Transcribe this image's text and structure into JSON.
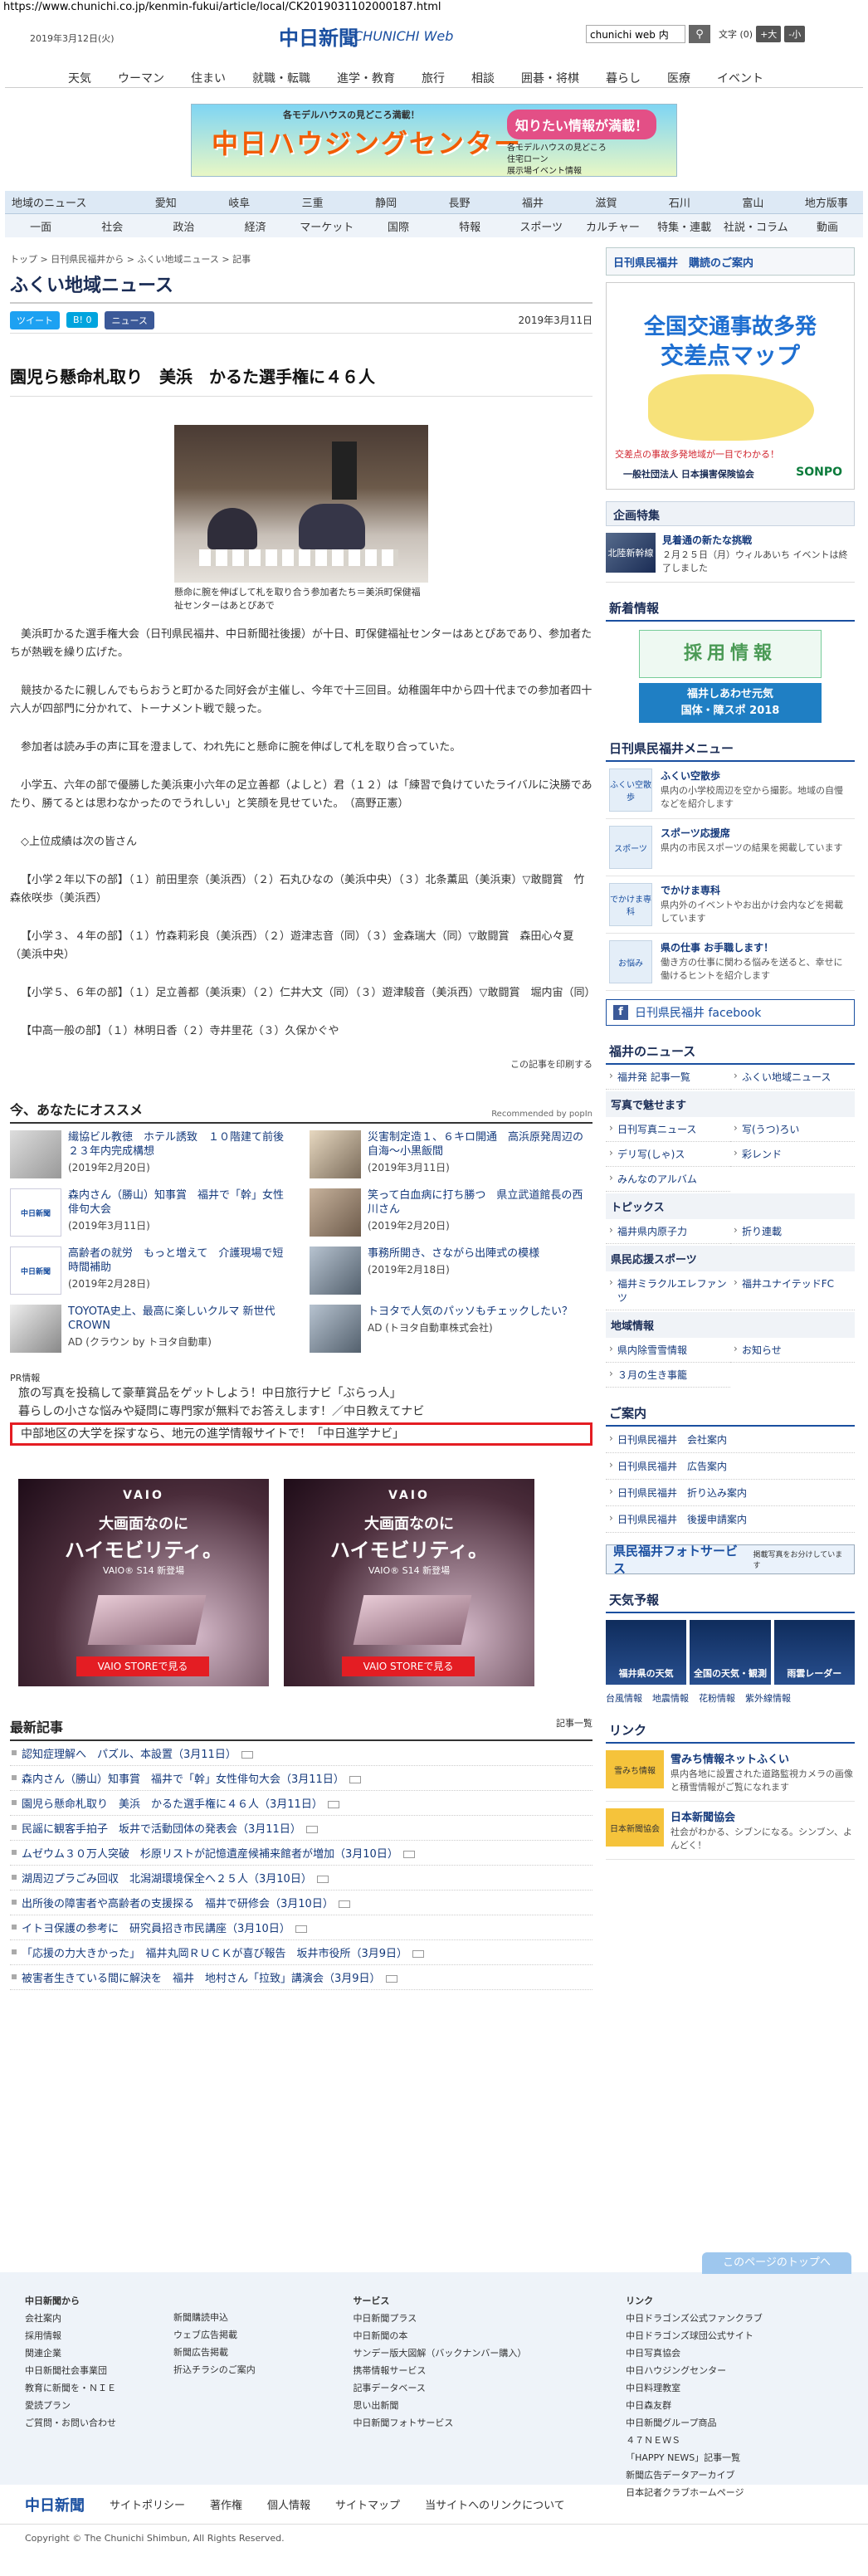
{
  "browser": {
    "url": "https://www.chunichi.co.jp/kenmin-fukui/article/local/CK2019031102000187.html"
  },
  "header": {
    "date": "2019年3月12日(火)",
    "logo": "中日新聞",
    "logo_en": "CHUNICHI Web",
    "search_value": "chunichi web 内",
    "search_icon": "search-icon",
    "font_label": "文字 (0)",
    "font_large": "+大",
    "font_small": "-小"
  },
  "global_nav": [
    "天気",
    "ウーマン",
    "住まい",
    "就職・転職",
    "進学・教育",
    "旅行",
    "相談",
    "囲碁・将棋",
    "暮らし",
    "医療",
    "イベント"
  ],
  "top_banner": {
    "small": "各モデルハウスの見どころ満載！",
    "main": "中日ハウジングセンター",
    "bubble": "知りたい情報が満載！",
    "list": [
      "各モデルハウスの見どころ",
      "住宅ローン",
      "展示場イベント情報"
    ]
  },
  "region_nav": {
    "row1": [
      "地域のニュース",
      "愛知",
      "岐阜",
      "三重",
      "静岡",
      "長野",
      "福井",
      "滋賀",
      "石川",
      "富山",
      "地方版事"
    ],
    "row2": [
      "一面",
      "社会",
      "政治",
      "経済",
      "マーケット",
      "国際",
      "特報",
      "スポーツ",
      "カルチャー",
      "特集・連載",
      "社説・コラム",
      "動画"
    ]
  },
  "breadcrumb": "トップ > 日刊県民福井から > ふくい地域ニュース > 記事",
  "section_title": "ふくい地域ニュース",
  "share": {
    "tweet": "ツイート",
    "hatena": "B! 0",
    "news": "ニュース",
    "date": "2019年3月11日"
  },
  "article": {
    "headline": "園児ら懸命札取り　美浜　かるた選手権に４６人",
    "caption": "懸命に腕を伸ばして札を取り合う参加者たち＝美浜町保健福祉センターはあとぴあで",
    "paragraphs": [
      "美浜町かるた選手権大会（日刊県民福井、中日新聞社後援）が十日、町保健福祉センターはあとぴあであり、参加者たちが熱戦を繰り広げた。",
      "競技かるたに親しんでもらおうと町かるた同好会が主催し、今年で十三回目。幼稚園年中から四十代までの参加者四十六人が四部門に分かれて、トーナメント戦で競った。",
      "参加者は読み手の声に耳を澄まして、われ先にと懸命に腕を伸ばして札を取り合っていた。",
      "小学五、六年の部で優勝した美浜東小六年の足立善都（よしと）君（１２）は「練習で負けていたライバルに決勝であたり、勝てるとは思わなかったのでうれしい」と笑顔を見せていた。　（高野正憲）",
      "◇上位成績は次の皆さん",
      "【小学２年以下の部】（１）前田里奈（美浜西）（２）石丸ひなの（美浜中央）（３）北条薫凪（美浜東）▽敢闘賞　竹森依咲歩（美浜西）",
      "【小学３、４年の部】（１）竹森莉彩良（美浜西）（２）遊津志音（同）（３）金森瑞大（同）▽敢闘賞　森田心々夏（美浜中央）",
      "【小学５、６年の部】（１）足立善都（美浜東）（２）仁井大文（同）（３）遊津駿音（美浜西）▽敢闘賞　堀内宙（同）",
      "【中高一般の部】（１）林明日香（２）寺井里花（３）久保かぐや"
    ],
    "print": "この記事を印刷する"
  },
  "recommend": {
    "title": "今、あなたにオススメ",
    "powered": "Recommended by popIn",
    "items": [
      {
        "title": "繊協ビル教徳　ホテル誘致　１０階建て前後　２３年内完成構想",
        "date": "(2019年2月20日)",
        "thumb": "photo"
      },
      {
        "title": "災害制定造１、６キロ開通　高浜原発周辺の自海～小黒飯間",
        "date": "(2019年3月11日)",
        "thumb": "photo"
      },
      {
        "title": "森内さん（勝山）知事賞　福井で「幹」女性俳句大会",
        "date": "(2019年3月11日)",
        "thumb": "中日新聞"
      },
      {
        "title": "笑って白血病に打ち勝つ　県立武道館長の西川さん",
        "date": "(2019年2月20日)",
        "thumb": "photo"
      },
      {
        "title": "高齢者の就労　もっと増えて　介護現場で短時間補助",
        "date": "(2019年2月28日)",
        "thumb": "中日新聞"
      },
      {
        "title": "事務所開き、さながら出陣式の模様",
        "date": "(2019年2月18日)",
        "thumb": "photo"
      },
      {
        "title": "TOYOTA史上、最高に楽しいクルマ 新世代CROWN",
        "date": "AD (クラウン by トヨタ自動車)",
        "thumb": "car"
      },
      {
        "title": "トヨタで人気のパッソもチェックしたい？",
        "date": "AD (トヨタ自動車株式会社)",
        "thumb": "car"
      }
    ]
  },
  "pr": {
    "label": "PR情報",
    "items": [
      "旅の写真を投稿して豪華賞品をゲットしよう！中日旅行ナビ「ぶらっ人」",
      "暮らしの小さな悩みや疑問に専門家が無料でお答えします！／中日教えてナビ",
      "中部地区の大学を探すなら、地元の進学情報サイトで！「中日進学ナビ」"
    ]
  },
  "ads": {
    "brand": "VAIO",
    "line1": "大画面なのに",
    "line2": "ハイモビリティ。",
    "line3": "VAIO® S14 新登場",
    "button": "VAIO STOREで見る"
  },
  "latest": {
    "title": "最新記事",
    "more": "記事一覧",
    "items": [
      "認知症理解へ　パズル、本設置（3月11日）",
      "森内さん（勝山）知事賞　福井で「幹」女性俳句大会（3月11日）",
      "園児ら懸命札取り　美浜　かるた選手権に４６人（3月11日）",
      "民謡に観客手拍子　坂井で活動団体の発表会（3月11日）",
      "ムゼウム３０万人突破　杉原リストが記憶遺産候補来館者が増加（3月10日）",
      "湖周辺プラごみ回収　北潟湖環境保全へ２５人（3月10日）",
      "出所後の障害者や高齢者の支援探る　福井で研修会（3月10日）",
      "イトヨ保護の参考に　研究員招き市民講座（3月10日）",
      "「応援の力大きかった」　福井丸岡ＲＵＣＫが喜び報告　坂井市役所（3月9日）",
      "被害者生きている間に解決を　福井　地村さん「拉致」講演会（3月9日）"
    ]
  },
  "sidebar": {
    "subscribe": "日刊県民福井　購読のご案内",
    "traffic_ad": {
      "title1": "全国交通事故多発",
      "title2": "交差点マップ",
      "sub": "交差点の事故多発地域が一目でわかる！",
      "org": "一般社団法人 日本損害保険協会",
      "logo": "SONPO"
    },
    "feature_title": "企画特集",
    "feature": {
      "thumb": "北陸新幹線",
      "title": "見着通の新たな挑戦",
      "desc": "２月２５日（月）ウィルあいち イベントは終了しました"
    },
    "recruit_title": "新着情報",
    "recruit": "採用情報",
    "recruit2": [
      "福井しあわせ元気",
      "国体・障スポ 2018"
    ],
    "menu_title": "日刊県民福井メニュー",
    "menu": [
      {
        "thumb": "ふくい空散歩",
        "title": "ふくい空散歩",
        "desc": "県内の小学校周辺を空から撮影。地域の自慢などを紹介します"
      },
      {
        "thumb": "スポーツ",
        "title": "スポーツ応援席",
        "desc": "県内の市民スポーツの結果を掲載しています"
      },
      {
        "thumb": "でかけま専科",
        "title": "でかけま専科",
        "desc": "県内外のイベントやお出かけ会内などを掲載しています"
      },
      {
        "thumb": "お悩み",
        "title": "県の仕事 お手職します！",
        "desc": "働き方の仕事に関わる悩みを送ると、幸せに働けるヒントを紹介します"
      }
    ],
    "facebook": "日刊県民福井 facebook",
    "fukui_news_title": "福井のニュース",
    "fukui_news": [
      "福井発 記事一覧",
      "ふくい地域ニュース"
    ],
    "cat_photo": "写真で魅せます",
    "photo_items": [
      "日刊写真ニュース",
      "写(うつ)ろい",
      "デリ写(しゃ)ス",
      "彩レンド",
      "みんなのアルバム"
    ],
    "cat_topics": "トピックス",
    "topics": [
      "福井県内原子力",
      "折り連載"
    ],
    "cat_sports": "県民応援スポーツ",
    "sports": [
      "福井ミラクルエレファンツ",
      "福井ユナイテッドFC"
    ],
    "cat_region": "地域情報",
    "region": [
      "県内除雪雪情報",
      "お知らせ",
      "３月の生き事籠"
    ],
    "guide_title": "ご案内",
    "guide": [
      "日刊県民福井　会社案内",
      "日刊県民福井　広告案内",
      "日刊県民福井　折り込み案内",
      "日刊県民福井　後援申請案内"
    ],
    "photo_service": "県民福井フォトサービス",
    "photo_service_note": "掲載写真をお分けしています",
    "weather_title": "天気予報",
    "weather": [
      "福井県の天気",
      "全国の天気・観測",
      "雨雲レーダー"
    ],
    "weather_links": [
      "台風情報",
      "地震情報",
      "花粉情報",
      "紫外線情報"
    ],
    "links_title": "リンク",
    "links": [
      {
        "thumb": "雪みち情報",
        "title": "雪みち情報ネットふくい",
        "desc": "県内各地に設置された道路監視カメラの画像と積雪情報がご覧になれます"
      },
      {
        "thumb": "日本新聞協会",
        "title": "日本新聞協会",
        "desc": "社会がわかる、シブンになる。シンブン、よんどく！"
      }
    ]
  },
  "footer": {
    "pagetop": "このページのトップへ",
    "col1_title": "中日新聞から",
    "col1": [
      "会社案内",
      "採用情報",
      "関連企業",
      "中日新聞社会事業団",
      "教育に新聞を・ＮＩＥ",
      "愛読プラン",
      "ご質問・お問い合わせ"
    ],
    "col2": [
      "新聞購読申込",
      "ウェブ広告掲載",
      "新聞広告掲載",
      "折込チラシのご案内"
    ],
    "col3_title": "サービス",
    "col3": [
      "中日新聞プラス",
      "中日新聞の本",
      "サンデー版大図解（バックナンバー購入）",
      "携帯情報サービス",
      "記事データベース",
      "思い出新聞",
      "中日新聞フォトサービス"
    ],
    "col4_title": "リンク",
    "col4": [
      "中日ドラゴンズ公式ファンクラブ",
      "中日ドラゴンズ球団公式サイト",
      "中日写真協会",
      "中日ハウジングセンター",
      "中日料理教室",
      "中日森友群",
      "中日新聞グループ商品",
      "４７ＮＥＷＳ",
      "「HAPPY NEWS」記事一覧",
      "新聞広告データアーカイブ",
      "日本記者クラブホームページ"
    ],
    "bottom_logo": "中日新聞",
    "bottom_links": [
      "サイトポリシー",
      "著作権",
      "個人情報",
      "サイトマップ",
      "当サイトへのリンクについて"
    ],
    "copyright": "Copyright © The Chunichi Shimbun, All Rights Reserved."
  }
}
